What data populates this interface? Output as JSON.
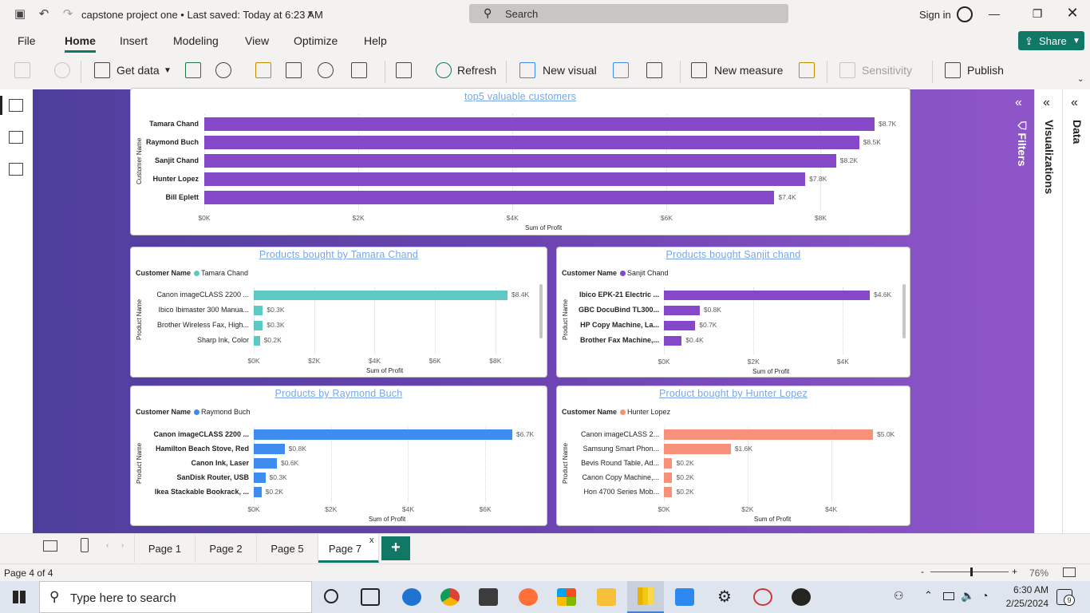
{
  "window": {
    "doc_title": "capstone project one • Last saved: Today at 6:23 AM",
    "search_label": "Search",
    "signin": "Sign in"
  },
  "menu": {
    "items": [
      "File",
      "Home",
      "Insert",
      "Modeling",
      "View",
      "Optimize",
      "Help"
    ],
    "share": "Share"
  },
  "ribbon": {
    "get_data": "Get data",
    "refresh": "Refresh",
    "new_visual": "New visual",
    "new_measure": "New measure",
    "sensitivity": "Sensitivity",
    "publish": "Publish"
  },
  "panes": {
    "filters": "Filters",
    "visualizations": "Visualizations",
    "data": "Data"
  },
  "pages": {
    "tabs": [
      "Page 1",
      "Page 2",
      "Page 5",
      "Page 7"
    ],
    "active": "Page 7",
    "close": "x",
    "add": "+"
  },
  "status": {
    "page_info": "Page 4 of 4",
    "zoom": "76%",
    "zoom_level": 0.76
  },
  "taskbar": {
    "search_placeholder": "Type here to search",
    "time": "6:30 AM",
    "date": "2/25/2024",
    "notifications": "9"
  },
  "colors": {
    "purple": "#8548c8",
    "teal": "#5ec9c4",
    "blue": "#3f8cf0",
    "salmon": "#f7917a",
    "accent": "#117865"
  },
  "chart_data": [
    {
      "type": "bar",
      "orientation": "horizontal",
      "title": "top5 valuable customers",
      "categories": [
        "Tamara Chand",
        "Raymond Buch",
        "Sanjit Chand",
        "Hunter Lopez",
        "Bill Eplett"
      ],
      "values": [
        8.7,
        8.5,
        8.2,
        7.8,
        7.4
      ],
      "data_labels": [
        "$8.7K",
        "$8.5K",
        "$8.2K",
        "$7.8K",
        "$7.4K"
      ],
      "xlabel": "Sum of Profit",
      "ylabel": "Customer Name",
      "xlim": [
        0,
        8.7
      ],
      "ticks": [
        "$0K",
        "$2K",
        "$4K",
        "$6K",
        "$8K"
      ],
      "color": "#8548c8"
    },
    {
      "type": "bar",
      "orientation": "horizontal",
      "title": "Products bought by Tamara Chand",
      "legend_title": "Customer Name",
      "legend_entry": "Tamara Chand",
      "categories": [
        "Canon imageCLASS 2200 ...",
        "Ibico Ibimaster 300 Manua...",
        "Brother Wireless Fax, High...",
        "Sharp Ink, Color"
      ],
      "values": [
        8.4,
        0.3,
        0.3,
        0.2
      ],
      "data_labels": [
        "$8.4K",
        "$0.3K",
        "$0.3K",
        "$0.2K"
      ],
      "xlabel": "Sum of Profit",
      "ylabel": "Product Name",
      "xlim": [
        0,
        8.4
      ],
      "ticks": [
        "$0K",
        "$2K",
        "$4K",
        "$6K",
        "$8K"
      ],
      "color": "#5ec9c4"
    },
    {
      "type": "bar",
      "orientation": "horizontal",
      "title": "Products bought Sanjit chand",
      "legend_title": "Customer Name",
      "legend_entry": "Sanjit Chand",
      "categories": [
        "Ibico EPK-21 Electric ...",
        "GBC DocuBind TL300...",
        "HP Copy Machine, La...",
        "Brother Fax Machine,..."
      ],
      "values": [
        4.6,
        0.8,
        0.7,
        0.4
      ],
      "data_labels": [
        "$4.6K",
        "$0.8K",
        "$0.7K",
        "$0.4K"
      ],
      "xlabel": "Sum of Profit",
      "ylabel": "Product Name",
      "xlim": [
        0,
        4.6
      ],
      "ticks": [
        "$0K",
        "$2K",
        "$4K"
      ],
      "color": "#8548c8"
    },
    {
      "type": "bar",
      "orientation": "horizontal",
      "title": "Products by Raymond Buch",
      "legend_title": "Customer Name",
      "legend_entry": "Raymond Buch",
      "categories": [
        "Canon imageCLASS 2200 ...",
        "Hamilton Beach Stove, Red",
        "Canon Ink, Laser",
        "SanDisk Router, USB",
        "Ikea Stackable Bookrack, ..."
      ],
      "values": [
        6.7,
        0.8,
        0.6,
        0.3,
        0.2
      ],
      "data_labels": [
        "$6.7K",
        "$0.8K",
        "$0.6K",
        "$0.3K",
        "$0.2K"
      ],
      "xlabel": "Sum of Profit",
      "ylabel": "Product Name",
      "xlim": [
        0,
        6.7
      ],
      "ticks": [
        "$0K",
        "$2K",
        "$4K",
        "$6K"
      ],
      "color": "#3f8cf0"
    },
    {
      "type": "bar",
      "orientation": "horizontal",
      "title": "Product bought by Hunter Lopez",
      "legend_title": "Customer Name",
      "legend_entry": "Hunter Lopez",
      "categories": [
        "Canon imageCLASS 2...",
        "Samsung Smart Phon...",
        "Bevis Round Table, Ad...",
        "Canon Copy Machine,...",
        "Hon 4700 Series Mob..."
      ],
      "values": [
        5.0,
        1.6,
        0.2,
        0.2,
        0.2
      ],
      "data_labels": [
        "$5.0K",
        "$1.6K",
        "$0.2K",
        "$0.2K",
        "$0.2K"
      ],
      "xlabel": "Sum of Profit",
      "ylabel": "Product Name",
      "xlim": [
        0,
        5.0
      ],
      "ticks": [
        "$0K",
        "$2K",
        "$4K"
      ],
      "color": "#f7917a"
    }
  ]
}
